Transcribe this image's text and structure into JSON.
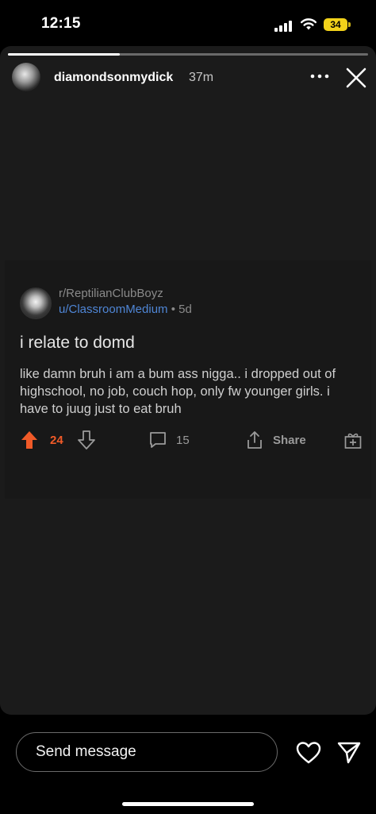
{
  "status_bar": {
    "time": "12:15",
    "battery_level": "34"
  },
  "story": {
    "progress_fraction": 0.31,
    "username": "diamondsonmydick",
    "posted_ago": "37m"
  },
  "post": {
    "subreddit": "r/ReptilianClubBoyz",
    "author": "u/ClassroomMedium",
    "age": "• 5d",
    "title": "i relate to domd",
    "body": "like damn bruh i am a bum ass nigga..  i dropped out of highschool, no job, couch hop, only fw younger girls. i have to juug  just to eat bruh",
    "votes": "24",
    "comments": "15",
    "share_label": "Share"
  },
  "reply": {
    "placeholder": "Send message"
  },
  "colors": {
    "upvote": "#f05a28",
    "author_link": "#4f86d6",
    "battery": "#f2d21a"
  }
}
